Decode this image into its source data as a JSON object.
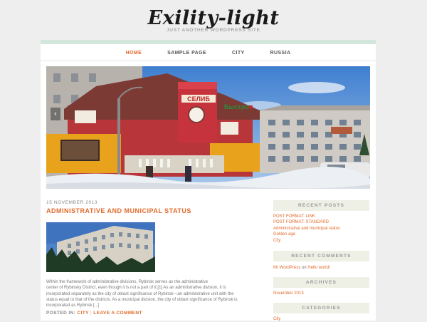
{
  "header": {
    "site_title": "Exility-light",
    "site_description": "JUST ANOTHER WORDPRESS SITE"
  },
  "nav": {
    "items": [
      "HOME",
      "SAMPLE PAGE",
      "CITY",
      "RUSSIA"
    ],
    "active": "HOME"
  },
  "slider": {
    "prev_icon": "chevron-left-icon",
    "sign_left": "СЕЛИБ",
    "sign_right": "Быстро",
    "sign_plus": "+"
  },
  "post": {
    "date": "15 NOVEMBER 2013",
    "title": "ADMINISTRATIVE AND MUNICIPAL STATUS",
    "excerpt_lines": [
      "Within the framework of administrative divisions, Rybinsk serves as the administrative",
      "center of Rybinsky District, even though it is not a part of it.[1] As an administrative division, it is",
      "incorporated separately as the city of oblast significance of Rybinsk—an administrative unit with the",
      "status equal to that of the districts.  As a municipal division, the city of oblast significance of Rybinsk is",
      "incorporated as Rybinsk [...]"
    ],
    "meta": {
      "posted_in_label": "POSTED IN:",
      "category": "CITY",
      "separator": "|",
      "comment_link": "LEAVE A COMMENT"
    }
  },
  "sidebar": {
    "recent_posts": {
      "title": "RECENT POSTS",
      "items": [
        "POST FORMAT: LINK",
        "POST FORMAT: STANDARD",
        "Administrative and municipal status",
        "Golden age",
        "City"
      ]
    },
    "recent_comments": {
      "title": "RECENT COMMENTS",
      "author": "Mr WordPress",
      "on_text": "on",
      "post": "Hello world!"
    },
    "archives": {
      "title": "ARCHIVES",
      "items": [
        "November 2013"
      ]
    },
    "categories": {
      "title": "CATEGORIES",
      "items": [
        "City"
      ]
    }
  },
  "colors": {
    "accent": "#e06a2b",
    "top_bar": "#d2e6dc",
    "widget_bg": "#eef0e6"
  }
}
